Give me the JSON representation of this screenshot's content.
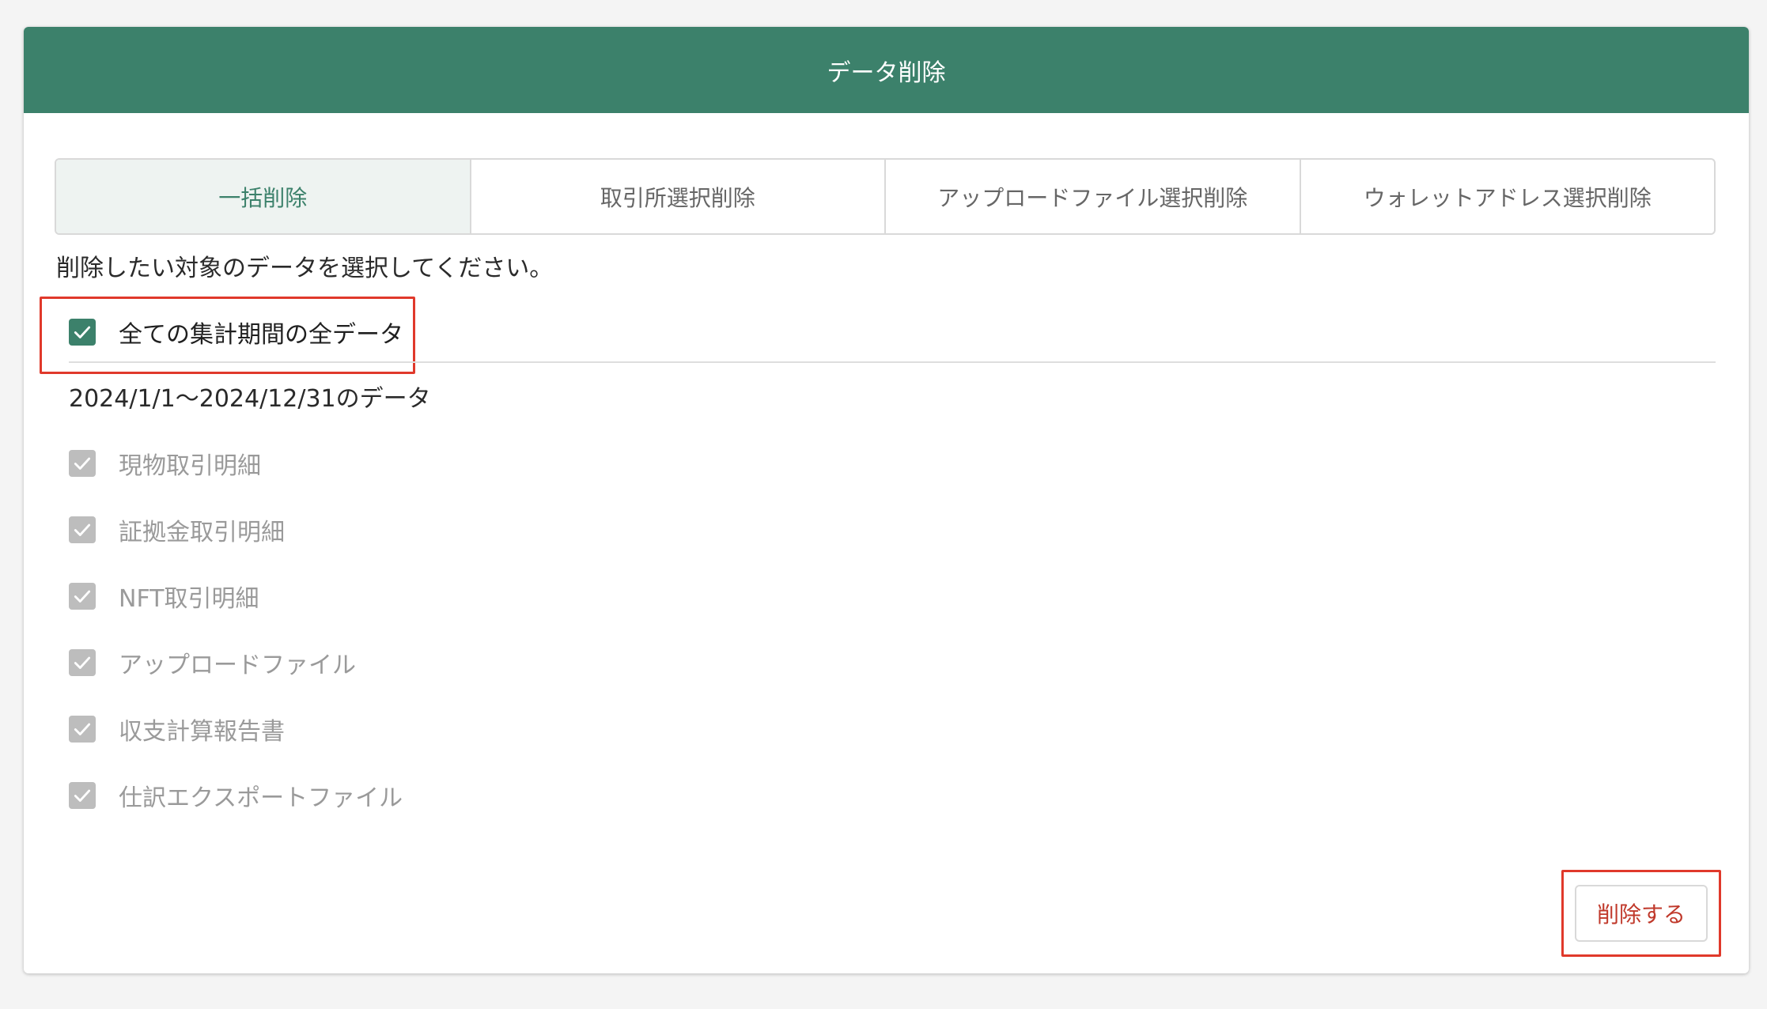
{
  "header": {
    "title": "データ削除"
  },
  "tabs": [
    {
      "label": "一括削除",
      "active": true
    },
    {
      "label": "取引所選択削除",
      "active": false
    },
    {
      "label": "アップロードファイル選択削除",
      "active": false
    },
    {
      "label": "ウォレットアドレス選択削除",
      "active": false
    }
  ],
  "instruction": "削除したい対象のデータを選択してください。",
  "all_data": {
    "label": "全ての集計期間の全データ",
    "checked": true
  },
  "period": {
    "label": "2024/1/1〜2024/12/31のデータ"
  },
  "items": [
    {
      "label": "現物取引明細",
      "checked": true,
      "disabled": true
    },
    {
      "label": "証拠金取引明細",
      "checked": true,
      "disabled": true
    },
    {
      "label": "NFT取引明細",
      "checked": true,
      "disabled": true
    },
    {
      "label": "アップロードファイル",
      "checked": true,
      "disabled": true
    },
    {
      "label": "収支計算報告書",
      "checked": true,
      "disabled": true
    },
    {
      "label": "仕訳エクスポートファイル",
      "checked": true,
      "disabled": true
    }
  ],
  "actions": {
    "delete_label": "削除する"
  },
  "colors": {
    "accent": "#3c816b",
    "danger": "#c0392b",
    "highlight": "#e0392b",
    "disabled": "#bdbdbd"
  }
}
